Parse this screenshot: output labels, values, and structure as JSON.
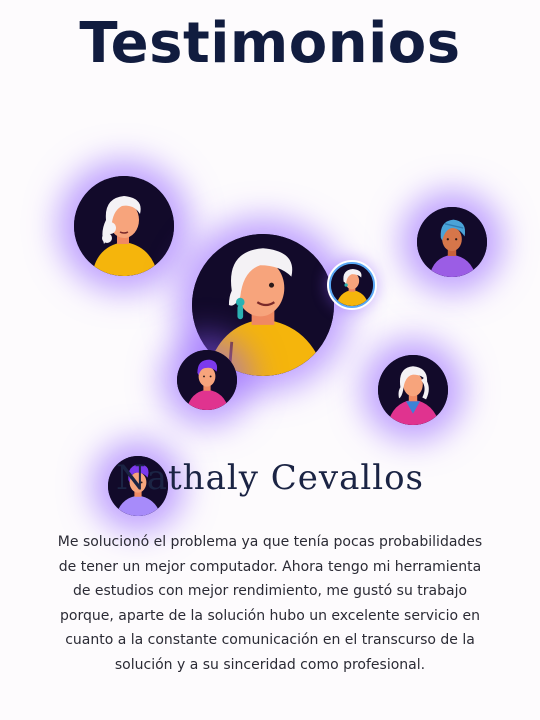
{
  "section": {
    "title": "Testimonios"
  },
  "testimonial": {
    "name": "Nathaly Cevallos",
    "quote": "Me solucionó el problema ya que tenía pocas probabilidades de tener un mejor computador. Ahora tengo mi herramienta de estudios con mejor rendimiento, me gustó su trabajo porque, aparte de la solución hubo un excelente servicio en cuanto a la constante comunicación en el transcurso de la solución y a su sinceridad como profesional."
  },
  "avatars": [
    {
      "id": "avatar-woman-white-hair-yellow",
      "selected": false
    },
    {
      "id": "avatar-woman-blue-headscarf-purple",
      "selected": false
    },
    {
      "id": "avatar-woman-white-hair-earrings-featured",
      "selected": true
    },
    {
      "id": "avatar-woman-white-hair-small-ring",
      "selected": false
    },
    {
      "id": "avatar-man-purple-hair-pink",
      "selected": false
    },
    {
      "id": "avatar-woman-white-hair-pink-scarf",
      "selected": false
    },
    {
      "id": "avatar-man-purple-hair-lavender",
      "selected": false
    }
  ],
  "colors": {
    "title": "#111c3f",
    "glow": "#8c5aff",
    "avatar_bg": "#120a2a",
    "yellow_shirt": "#f5b50c",
    "purple_shirt": "#9b5de5",
    "pink_shirt": "#e0338f"
  }
}
